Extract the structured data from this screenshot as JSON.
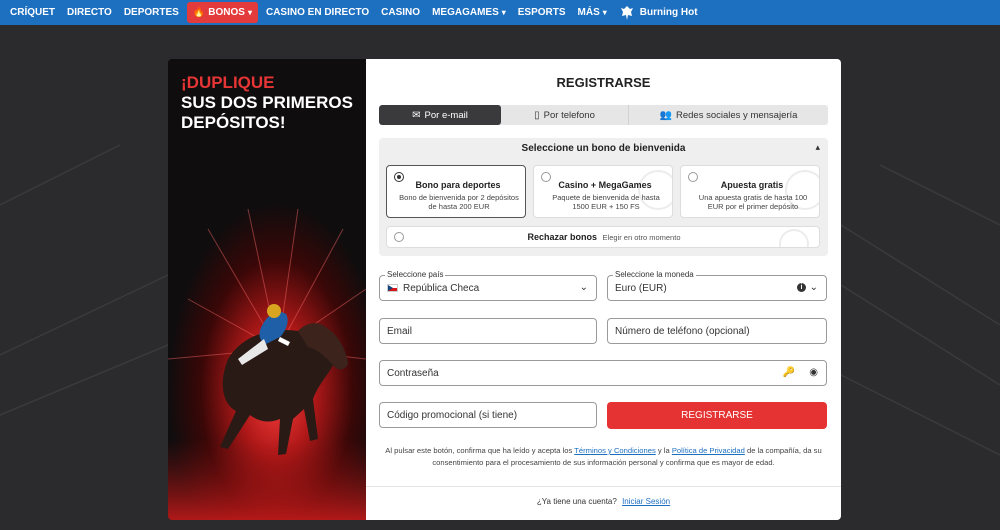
{
  "nav": {
    "items": [
      {
        "label": "CRÍQUET",
        "chevron": false,
        "active": false
      },
      {
        "label": "DIRECTO",
        "chevron": false,
        "active": false
      },
      {
        "label": "DEPORTES",
        "chevron": false,
        "active": false
      },
      {
        "label": "BONOS",
        "chevron": true,
        "active": true
      },
      {
        "label": "CASINO EN DIRECTO",
        "chevron": false,
        "active": false
      },
      {
        "label": "CASINO",
        "chevron": false,
        "active": false
      },
      {
        "label": "MEGAGAMES",
        "chevron": true,
        "active": false
      },
      {
        "label": "ESPORTS",
        "chevron": false,
        "active": false
      },
      {
        "label": "MÁS",
        "chevron": true,
        "active": false
      }
    ],
    "brand_label": "Burning Hot",
    "colors": {
      "bar": "#1d6fc0",
      "active": "#e33b3b"
    }
  },
  "promo": {
    "line1": "¡DUPLIQUE",
    "line2": "SUS DOS PRIMEROS",
    "line3": "DEPÓSITOS!"
  },
  "form": {
    "title": "REGISTRARSE",
    "tabs": [
      {
        "label": "Por e-mail",
        "icon": "envelope-icon"
      },
      {
        "label": "Por telefono",
        "icon": "phone-icon"
      },
      {
        "label": "Redes sociales y mensajería",
        "icon": "users-icon"
      }
    ],
    "bonus": {
      "heading": "Seleccione un bono de bienvenida",
      "cards": [
        {
          "title": "Bono para deportes",
          "desc": "Bono de bienvenida por 2 depósitos de hasta 200 EUR"
        },
        {
          "title": "Casino + MegaGames",
          "desc": "Paquete de bienvenida de hasta 1500 EUR + 150 FS"
        },
        {
          "title": "Apuesta gratis",
          "desc": "Una apuesta gratis de hasta 100 EUR por el primer depósito"
        }
      ],
      "reject_title": "Rechazar bonos",
      "reject_sub": "Elegir en otro momento"
    },
    "country": {
      "label": "Seleccione país",
      "value": "República Checa"
    },
    "currency": {
      "label": "Seleccione la moneda",
      "value": "Euro (EUR)"
    },
    "email_placeholder": "Email",
    "phone_placeholder": "Número de teléfono (opcional)",
    "password_placeholder": "Contraseña",
    "promo_placeholder": "Código promocional (si tiene)",
    "submit_label": "REGISTRARSE",
    "legal": {
      "before": "Al pulsar este botón, confirma que ha leído y acepta los",
      "terms": "Términos y Condiciones",
      "and": "y la",
      "privacy": "Política de Privacidad",
      "after": "de la compañía, da su consentimiento para el procesamiento de sus información personal y confirma que es mayor de edad."
    },
    "login_question": "¿Ya tiene una cuenta?",
    "login_link": "Iniciar Sesión"
  }
}
